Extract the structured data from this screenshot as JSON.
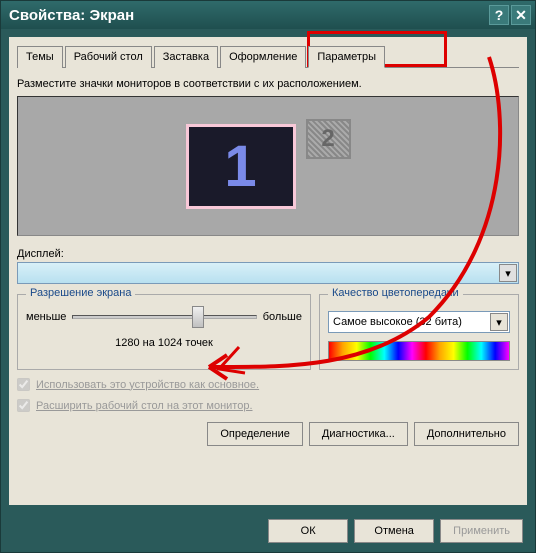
{
  "title": "Свойства: Экран",
  "titlebar": {
    "help": "?",
    "close": "✕"
  },
  "tabs": [
    "Темы",
    "Рабочий стол",
    "Заставка",
    "Оформление",
    "Параметры"
  ],
  "active_tab": 4,
  "instruction": "Разместите значки мониторов в соответствии с их расположением.",
  "monitors": {
    "m1": "1",
    "m2": "2"
  },
  "display_label": "Дисплей:",
  "display_value": "",
  "resolution": {
    "title": "Разрешение экрана",
    "less": "меньше",
    "more": "больше",
    "value": "1280 на 1024 точек"
  },
  "color": {
    "title": "Качество цветопередачи",
    "value": "Самое высокое (32 бита)"
  },
  "checks": {
    "primary": "Использовать это устройство как основное.",
    "extend": "Расширить рабочий стол на этот монитор."
  },
  "buttons": {
    "identify": "Определение",
    "diagnose": "Диагностика...",
    "advanced": "Дополнительно"
  },
  "footer": {
    "ok": "ОК",
    "cancel": "Отмена",
    "apply": "Применить"
  }
}
